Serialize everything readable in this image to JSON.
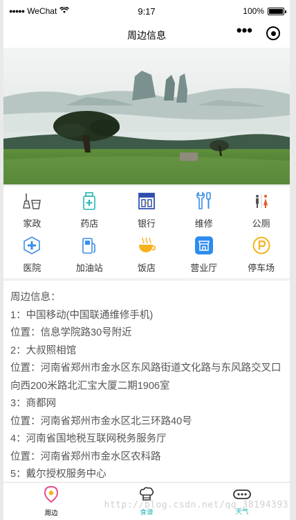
{
  "status_bar": {
    "signal": "●●●●●",
    "carrier": "WeChat",
    "time": "9:17",
    "battery": "100%",
    "battery_level": 1.0
  },
  "nav": {
    "title": "周边信息"
  },
  "services": [
    {
      "label": "家政",
      "icon": "broom-bucket-icon"
    },
    {
      "label": "药店",
      "icon": "medicine-bottle-icon"
    },
    {
      "label": "银行",
      "icon": "bank-icon"
    },
    {
      "label": "维修",
      "icon": "wrench-screwdriver-icon"
    },
    {
      "label": "公厕",
      "icon": "restroom-icon"
    },
    {
      "label": "医院",
      "icon": "hospital-cross-icon"
    },
    {
      "label": "加油站",
      "icon": "gas-station-icon"
    },
    {
      "label": "饭店",
      "icon": "coffee-cup-icon"
    },
    {
      "label": "营业厅",
      "icon": "service-hall-icon"
    },
    {
      "label": "停车场",
      "icon": "parking-icon"
    }
  ],
  "info": {
    "heading": "周边信息：",
    "lines": [
      "1：中国移动(中国联通维修手机)",
      "位置：信息学院路30号附近",
      "2：大叔照相馆",
      "位置：河南省郑州市金水区东风路街道文化路与东风路交叉口向西200米路北汇宝大厦二期1906室",
      "3：商都网",
      "位置：河南省郑州市金水区北三环路40号",
      "4：河南省国地税互联网税务服务厅",
      "位置：河南省郑州市金水区农科路",
      "5：戴尔授权服务中心"
    ]
  },
  "tabs": [
    {
      "label": "周边",
      "icon": "location-pin-icon"
    },
    {
      "label": "食谱",
      "icon": "chef-hat-icon"
    },
    {
      "label": "天气",
      "icon": "weather-icon"
    }
  ],
  "watermark": "http://blog.csdn.net/qq_38194393",
  "colors": {
    "teal": "#21b5b3",
    "blue": "#3a8ee6",
    "orange": "#f6b21c",
    "pink": "#e64c8c"
  }
}
